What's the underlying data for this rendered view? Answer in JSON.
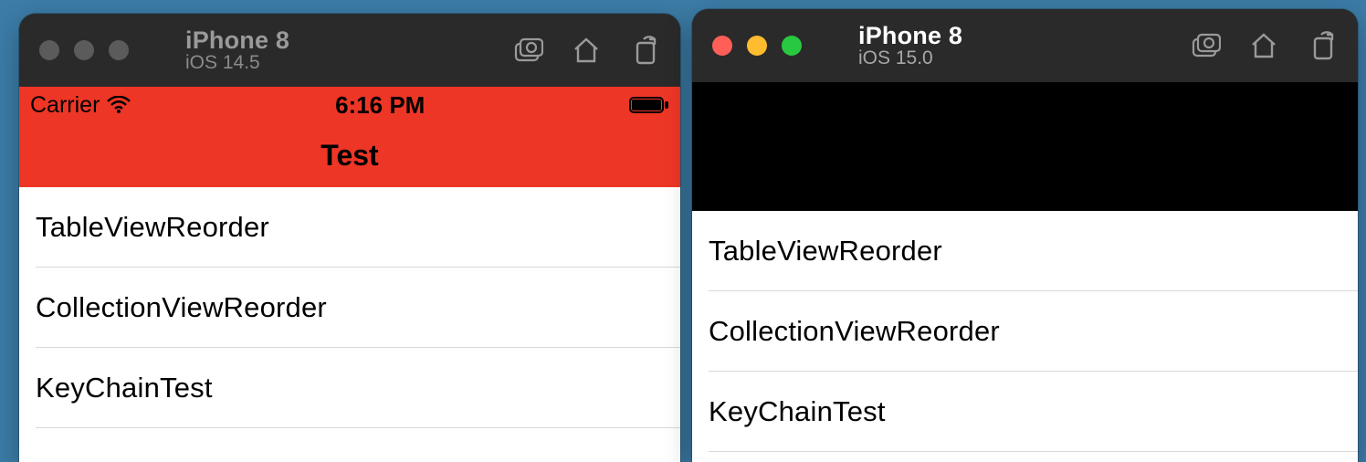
{
  "left": {
    "titlebar": {
      "device": "iPhone 8",
      "os": "iOS 14.5",
      "traffic_style": "dim"
    },
    "statusbar": {
      "carrier": "Carrier",
      "time": "6:16 PM"
    },
    "nav_title": "Test",
    "rows": [
      "TableViewReorder",
      "CollectionViewReorder",
      "KeyChainTest"
    ]
  },
  "right": {
    "titlebar": {
      "device": "iPhone 8",
      "os": "iOS 15.0",
      "traffic_style": "color"
    },
    "rows": [
      "TableViewReorder",
      "CollectionViewReorder",
      "KeyChainTest"
    ]
  },
  "colors": {
    "navbar_red": "#ee3626",
    "titlebar_bg": "#2a2a2a"
  }
}
